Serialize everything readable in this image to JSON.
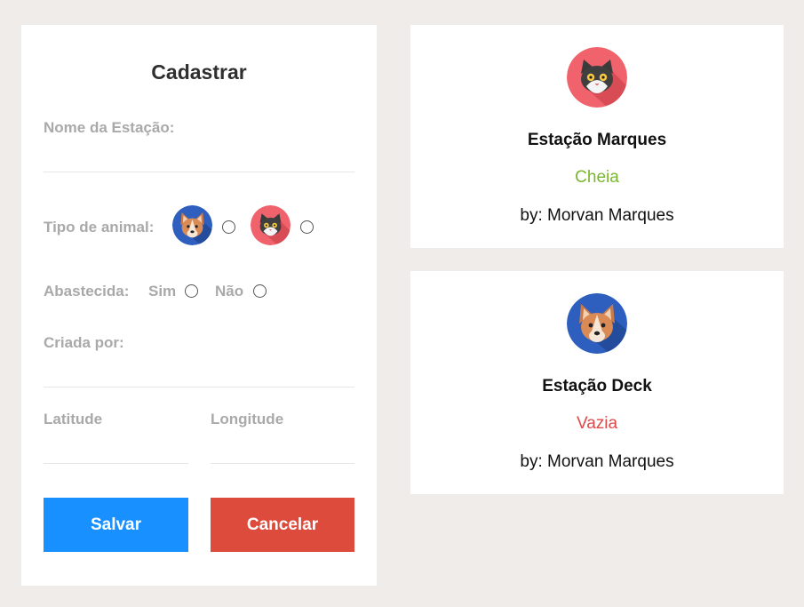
{
  "form": {
    "title": "Cadastrar",
    "station_name_label": "Nome da Estação:",
    "station_name_value": "",
    "animal_type_label": "Tipo de animal:",
    "animal_options": [
      {
        "icon": "dog-icon"
      },
      {
        "icon": "cat-icon"
      }
    ],
    "supplied_label": "Abastecida:",
    "supplied_yes": "Sim",
    "supplied_no": "Não",
    "created_by_label": "Criada por:",
    "created_by_value": "",
    "latitude_label": "Latitude",
    "longitude_label": "Longitude",
    "save_label": "Salvar",
    "cancel_label": "Cancelar"
  },
  "colors": {
    "save": "#1890ff",
    "cancel": "#dc4b3c",
    "full": "#7ab62e",
    "empty": "#dc4b4b",
    "cat_bg": "#f0636c",
    "dog_bg": "#2e5fbf"
  },
  "stations": [
    {
      "name": "Estação Marques",
      "status": "Cheia",
      "status_color": "#7ab62e",
      "by": "by: Morvan Marques",
      "animal_icon": "cat-icon"
    },
    {
      "name": "Estação Deck",
      "status": "Vazia",
      "status_color": "#dc4b4b",
      "by": "by: Morvan Marques",
      "animal_icon": "dog-icon"
    }
  ]
}
